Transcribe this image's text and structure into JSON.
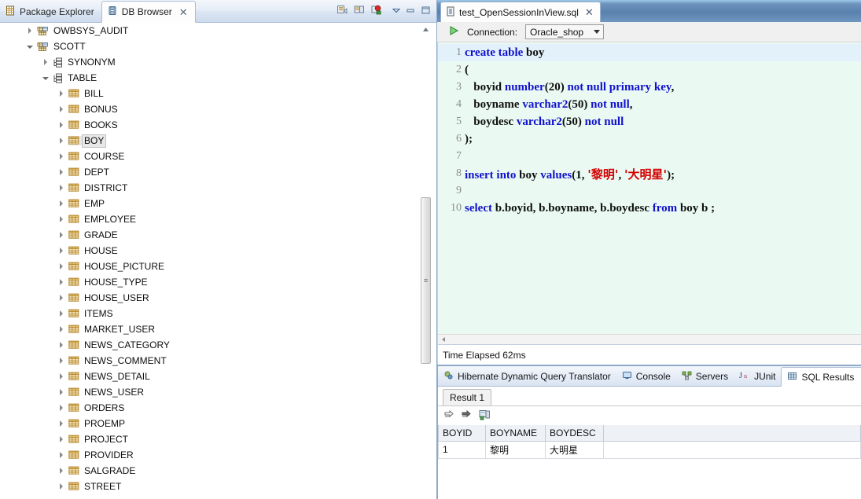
{
  "left_view": {
    "tabs": [
      {
        "label": "Package Explorer",
        "icon": "package-explorer-icon",
        "active": false,
        "closable": false
      },
      {
        "label": "DB Browser",
        "icon": "db-browser-icon",
        "active": true,
        "closable": true
      }
    ],
    "toolbar_icons": [
      "new-connection-icon",
      "refresh-connection-icon",
      "stop-connection-icon"
    ],
    "view_menu_icon": "view-menu-chevron-icon",
    "minimize_icon": "minimize-icon",
    "maximize_icon": "maximize-icon",
    "close_label": "✕",
    "tree": [
      {
        "label": "OWBSYS_AUDIT",
        "indent": 1,
        "state": "collapsed",
        "icon": "schema-icon",
        "selected": false
      },
      {
        "label": "SCOTT",
        "indent": 1,
        "state": "expanded",
        "icon": "schema-icon",
        "selected": false
      },
      {
        "label": "SYNONYM",
        "indent": 2,
        "state": "collapsed",
        "icon": "folder-group-icon",
        "selected": false
      },
      {
        "label": "TABLE",
        "indent": 2,
        "state": "expanded",
        "icon": "folder-group-icon",
        "selected": false
      },
      {
        "label": "BILL",
        "indent": 3,
        "state": "collapsed",
        "icon": "table-icon",
        "selected": false
      },
      {
        "label": "BONUS",
        "indent": 3,
        "state": "collapsed",
        "icon": "table-icon",
        "selected": false
      },
      {
        "label": "BOOKS",
        "indent": 3,
        "state": "collapsed",
        "icon": "table-icon",
        "selected": false
      },
      {
        "label": "BOY",
        "indent": 3,
        "state": "collapsed",
        "icon": "table-icon",
        "selected": true
      },
      {
        "label": "COURSE",
        "indent": 3,
        "state": "collapsed",
        "icon": "table-icon",
        "selected": false
      },
      {
        "label": "DEPT",
        "indent": 3,
        "state": "collapsed",
        "icon": "table-icon",
        "selected": false
      },
      {
        "label": "DISTRICT",
        "indent": 3,
        "state": "collapsed",
        "icon": "table-icon",
        "selected": false
      },
      {
        "label": "EMP",
        "indent": 3,
        "state": "collapsed",
        "icon": "table-icon",
        "selected": false
      },
      {
        "label": "EMPLOYEE",
        "indent": 3,
        "state": "collapsed",
        "icon": "table-icon",
        "selected": false
      },
      {
        "label": "GRADE",
        "indent": 3,
        "state": "collapsed",
        "icon": "table-icon",
        "selected": false
      },
      {
        "label": "HOUSE",
        "indent": 3,
        "state": "collapsed",
        "icon": "table-icon",
        "selected": false
      },
      {
        "label": "HOUSE_PICTURE",
        "indent": 3,
        "state": "collapsed",
        "icon": "table-icon",
        "selected": false
      },
      {
        "label": "HOUSE_TYPE",
        "indent": 3,
        "state": "collapsed",
        "icon": "table-icon",
        "selected": false
      },
      {
        "label": "HOUSE_USER",
        "indent": 3,
        "state": "collapsed",
        "icon": "table-icon",
        "selected": false
      },
      {
        "label": "ITEMS",
        "indent": 3,
        "state": "collapsed",
        "icon": "table-icon",
        "selected": false
      },
      {
        "label": "MARKET_USER",
        "indent": 3,
        "state": "collapsed",
        "icon": "table-icon",
        "selected": false
      },
      {
        "label": "NEWS_CATEGORY",
        "indent": 3,
        "state": "collapsed",
        "icon": "table-icon",
        "selected": false
      },
      {
        "label": "NEWS_COMMENT",
        "indent": 3,
        "state": "collapsed",
        "icon": "table-icon",
        "selected": false
      },
      {
        "label": "NEWS_DETAIL",
        "indent": 3,
        "state": "collapsed",
        "icon": "table-icon",
        "selected": false
      },
      {
        "label": "NEWS_USER",
        "indent": 3,
        "state": "collapsed",
        "icon": "table-icon",
        "selected": false
      },
      {
        "label": "ORDERS",
        "indent": 3,
        "state": "collapsed",
        "icon": "table-icon",
        "selected": false
      },
      {
        "label": "PROEMP",
        "indent": 3,
        "state": "collapsed",
        "icon": "table-icon",
        "selected": false
      },
      {
        "label": "PROJECT",
        "indent": 3,
        "state": "collapsed",
        "icon": "table-icon",
        "selected": false
      },
      {
        "label": "PROVIDER",
        "indent": 3,
        "state": "collapsed",
        "icon": "table-icon",
        "selected": false
      },
      {
        "label": "SALGRADE",
        "indent": 3,
        "state": "collapsed",
        "icon": "table-icon",
        "selected": false
      },
      {
        "label": "STREET",
        "indent": 3,
        "state": "collapsed",
        "icon": "table-icon",
        "selected": false
      }
    ]
  },
  "editor": {
    "tab": {
      "label": "test_OpenSessionInView.sql",
      "icon": "sql-file-icon",
      "close_label": "✕"
    },
    "toolbar": {
      "run_icon": "run-play-icon",
      "connection_label": "Connection:",
      "connection_value": "Oracle_shop"
    },
    "lines": [
      {
        "n": "1",
        "cur": true,
        "segments": [
          {
            "t": "create table ",
            "c": "kw"
          },
          {
            "t": "boy",
            "c": "pl"
          }
        ]
      },
      {
        "n": "2",
        "cur": false,
        "segments": [
          {
            "t": "(",
            "c": "pl"
          }
        ]
      },
      {
        "n": "3",
        "cur": false,
        "segments": [
          {
            "t": "   boyid ",
            "c": "pl"
          },
          {
            "t": "number",
            "c": "kw"
          },
          {
            "t": "(20) ",
            "c": "pl"
          },
          {
            "t": "not null primary key",
            "c": "kw"
          },
          {
            "t": ",",
            "c": "pl"
          }
        ]
      },
      {
        "n": "4",
        "cur": false,
        "segments": [
          {
            "t": "   boyname ",
            "c": "pl"
          },
          {
            "t": "varchar2",
            "c": "kw"
          },
          {
            "t": "(50) ",
            "c": "pl"
          },
          {
            "t": "not null",
            "c": "kw"
          },
          {
            "t": ",",
            "c": "pl"
          }
        ]
      },
      {
        "n": "5",
        "cur": false,
        "segments": [
          {
            "t": "   boydesc ",
            "c": "pl"
          },
          {
            "t": "varchar2",
            "c": "kw"
          },
          {
            "t": "(50) ",
            "c": "pl"
          },
          {
            "t": "not null",
            "c": "kw"
          }
        ]
      },
      {
        "n": "6",
        "cur": false,
        "segments": [
          {
            "t": ");",
            "c": "pl"
          }
        ]
      },
      {
        "n": "7",
        "cur": false,
        "segments": []
      },
      {
        "n": "8",
        "cur": false,
        "segments": [
          {
            "t": "insert into ",
            "c": "kw"
          },
          {
            "t": "boy ",
            "c": "pl"
          },
          {
            "t": "values",
            "c": "kw"
          },
          {
            "t": "(1, ",
            "c": "pl"
          },
          {
            "t": "'黎明'",
            "c": "str"
          },
          {
            "t": ", ",
            "c": "pl"
          },
          {
            "t": "'大明星'",
            "c": "str"
          },
          {
            "t": ");",
            "c": "pl"
          }
        ]
      },
      {
        "n": "9",
        "cur": false,
        "segments": []
      },
      {
        "n": "10",
        "cur": false,
        "segments": [
          {
            "t": "select ",
            "c": "kw"
          },
          {
            "t": "b.boyid, b.boyname, b.boydesc ",
            "c": "pl"
          },
          {
            "t": "from ",
            "c": "kw"
          },
          {
            "t": "boy b ;",
            "c": "pl"
          }
        ]
      }
    ],
    "status_text": "Time Elapsed 62ms"
  },
  "bottom_view": {
    "tabs": [
      {
        "label": "Hibernate Dynamic Query Translator",
        "icon": "hibernate-icon",
        "active": false,
        "closable": false
      },
      {
        "label": "Console",
        "icon": "console-icon",
        "active": false,
        "closable": false
      },
      {
        "label": "Servers",
        "icon": "servers-icon",
        "active": false,
        "closable": false
      },
      {
        "label": "JUnit",
        "icon": "junit-icon",
        "active": false,
        "closable": false
      },
      {
        "label": "SQL Results",
        "icon": "sql-results-icon",
        "active": true,
        "closable": true
      }
    ],
    "close_label": "✕",
    "result_tab": "Result 1",
    "grid_toolbar_icons": [
      "export-row-icon",
      "export-all-icon",
      "save-result-icon"
    ],
    "grid": {
      "columns": [
        "BOYID",
        "BOYNAME",
        "BOYDESC"
      ],
      "rows": [
        [
          "1",
          "黎明",
          "大明星"
        ]
      ]
    }
  }
}
